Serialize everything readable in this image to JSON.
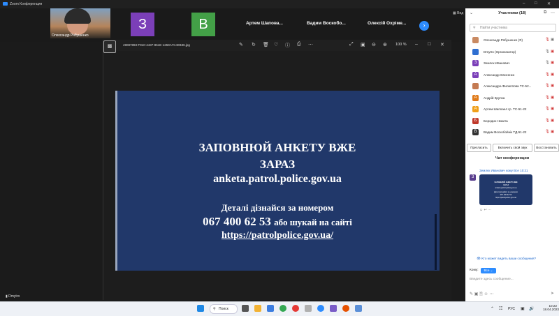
{
  "window": {
    "title": "Zoom Конференция",
    "view_label": "Вид"
  },
  "gallery": {
    "video_tile_name": "Олександр Рябушенко",
    "tiles": [
      {
        "letter": "З",
        "color": "#7b3fb8"
      },
      {
        "letter": "В",
        "color": "#43a047"
      }
    ],
    "names": [
      "Артем Шапова...",
      "Вадим Воскобо...",
      "Олексій Охріме..."
    ]
  },
  "self_label": "Dmytro",
  "viewer": {
    "filename": "49087893-F910-4437-851E-1259A7C40B36.jpg",
    "zoom": "100 %",
    "slide": {
      "line1": "ЗАПОВНЮЙ АНКЕТУ ВЖЕ",
      "line2": "ЗАРАЗ",
      "line3": "anketa.patrol.police.gov.ua",
      "line4": "Деталі дізнайся за номером",
      "phone": "067 400 62 53",
      "phone_suffix": "або шукай на сайті",
      "url": "https://patrolpolice.gov.ua/"
    }
  },
  "participants": {
    "title": "Участники (18)",
    "search_placeholder": "Найти участника",
    "rows": [
      {
        "initial": "",
        "name": "Олександр Рябушенко (Я)",
        "avatar_color": "#c98a62"
      },
      {
        "initial": "",
        "name": "Dmytro (Организатор)",
        "avatar_color": "#2f6fd1"
      },
      {
        "initial": "З",
        "name": "Землєк Иванович",
        "avatar_color": "#7b3fb8"
      },
      {
        "initial": "A",
        "name": "Александр Евсеенко",
        "avatar_color": "#7b3fb8"
      },
      {
        "initial": "",
        "name": "Александра Филиппова ТС-52...",
        "avatar_color": "#c47a52"
      },
      {
        "initial": "A",
        "name": "Андрій Крупка",
        "avatar_color": "#e07b1a"
      },
      {
        "initial": "A",
        "name": "Артем Шапоаел гр. ТС-51-22",
        "avatar_color": "#f0a01a"
      },
      {
        "initial": "Б",
        "name": "Бородин Никита",
        "avatar_color": "#c0392b"
      },
      {
        "initial": "В",
        "name": "Вадим Воскобойнік ТД-51-22",
        "avatar_color": "#333333"
      }
    ],
    "buttons": [
      "Пригласить",
      "Включить свой звук",
      "Восстановить"
    ]
  },
  "chat": {
    "title": "Чат конференции",
    "sender": "Землєк Иванович кому Все 10:21",
    "avatar_letter": "З",
    "who_sees": "Кто может видеть ваши сообщения?",
    "to_label": "Кому:",
    "to_value": "Все",
    "input_placeholder": "Введите здесь сообщение..."
  },
  "taskbar": {
    "search_label": "Поиск",
    "lang": "РУС",
    "time": "10:22",
    "date": "18.04.2023"
  }
}
